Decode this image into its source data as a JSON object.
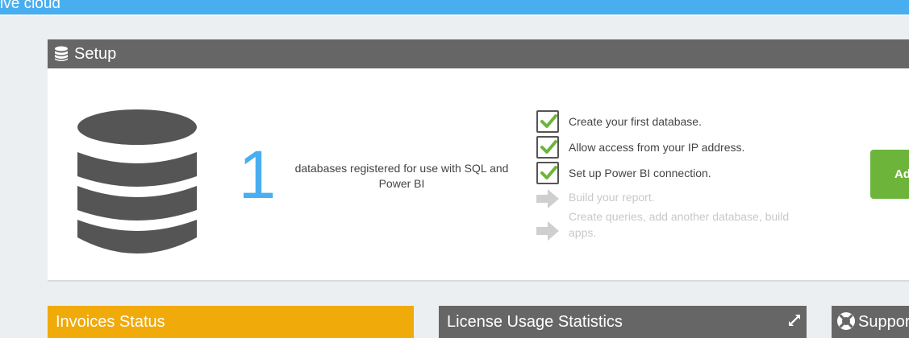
{
  "app": {
    "title": "ive cloud"
  },
  "setup": {
    "title": "Setup",
    "count": "1",
    "count_description": "databases registered for use with SQL and Power BI",
    "add_button_label": "Ad",
    "steps": [
      {
        "label": "Create your first database.",
        "status": "done"
      },
      {
        "label": "Allow access from your IP address.",
        "status": "done"
      },
      {
        "label": "Set up Power BI connection.",
        "status": "done"
      },
      {
        "label": "Build your report.",
        "status": "pending"
      },
      {
        "label": "Create queries, add another database, build apps.",
        "status": "pending"
      }
    ]
  },
  "cards": {
    "invoices": {
      "title": "Invoices Status"
    },
    "license": {
      "title": "License Usage Statistics"
    },
    "support": {
      "title": "Suppor"
    }
  },
  "colors": {
    "topbar": "#48aef0",
    "panel_header": "#666666",
    "count_blue": "#49aff1",
    "check_green": "#6cb53a",
    "add_button": "#6cb53a",
    "invoices_header": "#f0aa09"
  },
  "icons": {
    "setup_header": "database-icon",
    "setup_main": "database-icon",
    "done_step": "checkbox-checked-icon",
    "pending_step": "arrow-right-icon",
    "license_expand": "expand-icon",
    "support": "lifebuoy-icon"
  }
}
